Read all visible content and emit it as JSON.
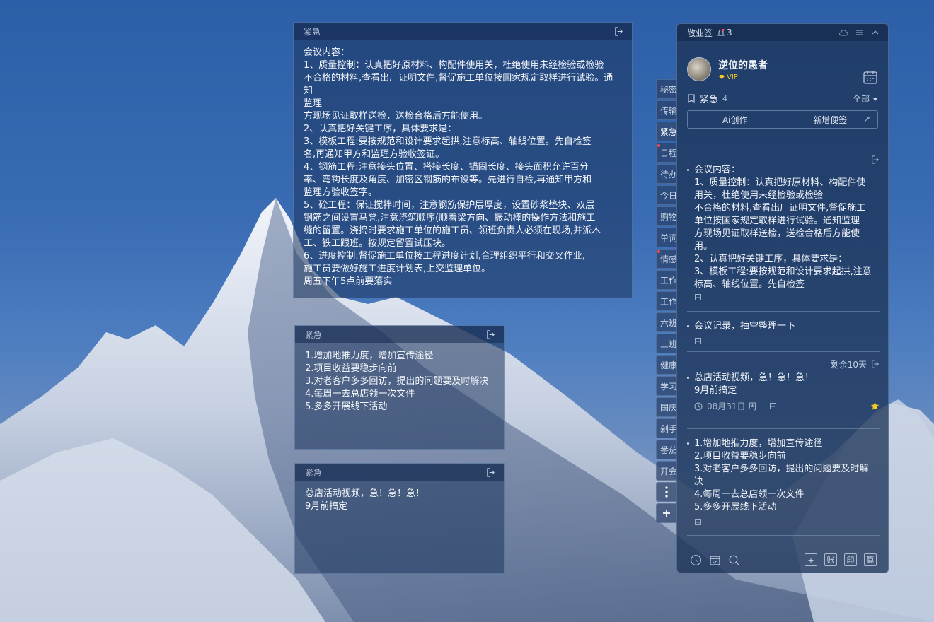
{
  "notes": [
    {
      "header": "紧急",
      "body": "会议内容：\n1、质量控制：认真把好原材料、构配件使用关，杜绝使用未经检验或检验\n不合格的材料,查看出厂证明文件,督促施工单位按国家规定取样进行试验。通知\n监理\n方现场见证取样送检，送检合格后方能使用。\n2、认真把好关键工序，具体要求是：\n3、模板工程:要按规范和设计要求起拱,注意标高、轴线位置。先自检签\n名,再通知甲方和监理方验收签证。\n4、钢筋工程:注意接头位置、搭接长度、锚固长度、接头面积允许百分\n率、弯钩长度及角度、加密区钢筋的布设等。先进行自检,再通知甲方和\n监理方验收签字。\n5、砼工程：保证搅拌时间，注意钢筋保护层厚度，设置砂浆垫块、双层\n钢筋之间设置马凳,注意浇筑顺序(顺着梁方向、振动棒的操作方法和施工\n缝的留置。浇捣时要求施工单位的施工员、领班负责人必须在现场,并派木\n工、铁工跟班。按规定留置试压块。\n6、进度控制:督促施工单位按工程进度计划,合理组织平行和交叉作业,\n施工员要做好施工进度计划表,上交监理单位。\n周五下午5点前要落实"
    },
    {
      "header": "紧急",
      "body": "1.增加地推力度，增加宣传途径\n2.项目收益要稳步向前\n3.对老客户多多回访，提出的问题要及时解决\n4.每周一去总店领一次文件\n5.多多开展线下活动"
    },
    {
      "header": "紧急",
      "body": "总店活动视频，急！急！急！\n9月前搞定"
    }
  ],
  "tabs": [
    {
      "label": "秘密",
      "dot": false,
      "active": false
    },
    {
      "label": "传输",
      "dot": false,
      "active": false
    },
    {
      "label": "紧急",
      "dot": false,
      "active": true
    },
    {
      "label": "日程",
      "dot": true,
      "active": false
    },
    {
      "label": "待办",
      "dot": false,
      "active": false
    },
    {
      "label": "今日",
      "dot": false,
      "active": false
    },
    {
      "label": "购物",
      "dot": false,
      "active": false
    },
    {
      "label": "单词",
      "dot": false,
      "active": false
    },
    {
      "label": "情感",
      "dot": true,
      "active": false
    },
    {
      "label": "工作",
      "dot": false,
      "active": false
    },
    {
      "label": "工作",
      "dot": false,
      "active": false
    },
    {
      "label": "六班",
      "dot": false,
      "active": false
    },
    {
      "label": "三班",
      "dot": false,
      "active": false
    },
    {
      "label": "健康",
      "dot": false,
      "active": false
    },
    {
      "label": "学习",
      "dot": false,
      "active": false
    },
    {
      "label": "国庆",
      "dot": false,
      "active": false
    },
    {
      "label": "剁手",
      "dot": false,
      "active": false
    },
    {
      "label": "番茄",
      "dot": false,
      "active": false
    },
    {
      "label": "开会",
      "dot": false,
      "active": false
    }
  ],
  "tab_more_icon": "more-vertical-icon",
  "tab_add_icon": "plus-icon",
  "panel": {
    "app_name": "敬业签",
    "notification_count": "3",
    "username": "逆位的愚者",
    "vip_label": "VIP",
    "group_name": "紧急",
    "group_count": "4",
    "filter_label": "全部",
    "ai_button": "Ai创作",
    "new_note_button": "新增便签",
    "items": [
      {
        "text": "会议内容：\n1、质量控制：认真把好原材料、构配件使\n用关，杜绝使用未经检验或检验\n不合格的材料,查看出厂证明文件,督促施工\n单位按国家规定取样进行试验。通知监理\n方现场见证取样送检，送检合格后方能使\n用。\n2、认真把好关键工序，具体要求是：\n3、模板工程:要按规范和设计要求起拱,注意\n标高、轴线位置。先自检签"
      },
      {
        "text": "会议记录，抽空整理一下"
      },
      {
        "remaining": "剩余10天",
        "text": "总店活动视频，急！急！急！\n9月前搞定",
        "date": "08月31日 周一"
      },
      {
        "text": "1.增加地推力度，增加宣传途径\n2.项目收益要稳步向前\n3.对老客户多多回访，提出的问题要及时解\n决\n4.每周一去总店领一次文件\n5.多多开展线下活动"
      }
    ],
    "footer_boxes": [
      "+",
      "账",
      "印",
      "算"
    ]
  },
  "colors": {
    "sky": "#2d5fa8",
    "panel_bg": "#1e3458",
    "vip": "#f5c924",
    "star": "#f5c924",
    "badge": "#ff4a4a"
  }
}
